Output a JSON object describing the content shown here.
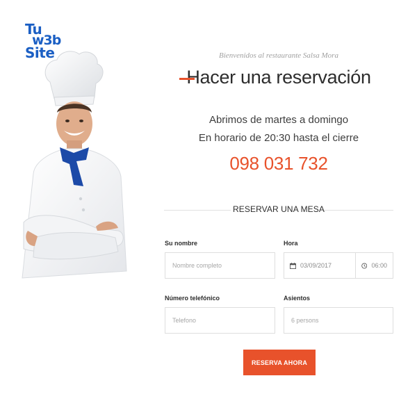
{
  "logo": {
    "line1": "Tu",
    "line2": "w3b",
    "line3": "Site",
    "color": "#1b5fc4"
  },
  "header": {
    "welcome": "Bienvenidos al restaurante Salsa Mora",
    "title": "Hacer una reservación",
    "hours_line1": "Abrimos de martes a domingo",
    "hours_line2": "En horario de 20:30 hasta el cierre",
    "phone": "098 031 732"
  },
  "form": {
    "section_title": "RESERVAR UNA MESA",
    "name": {
      "label": "Su nombre",
      "placeholder": "Nombre completo"
    },
    "time": {
      "label": "Hora",
      "date_value": "03/09/2017",
      "time_value": "06:00"
    },
    "phone": {
      "label": "Número telefónico",
      "placeholder": "Telefono"
    },
    "seats": {
      "label": "Asientos",
      "placeholder": "6 persons"
    },
    "submit_label": "RESERVA AHORA"
  },
  "colors": {
    "accent": "#e8522b",
    "text": "#2d2d2d",
    "border": "#dedede"
  },
  "icons": {
    "date": "calendar-icon",
    "time": "clock-icon"
  }
}
